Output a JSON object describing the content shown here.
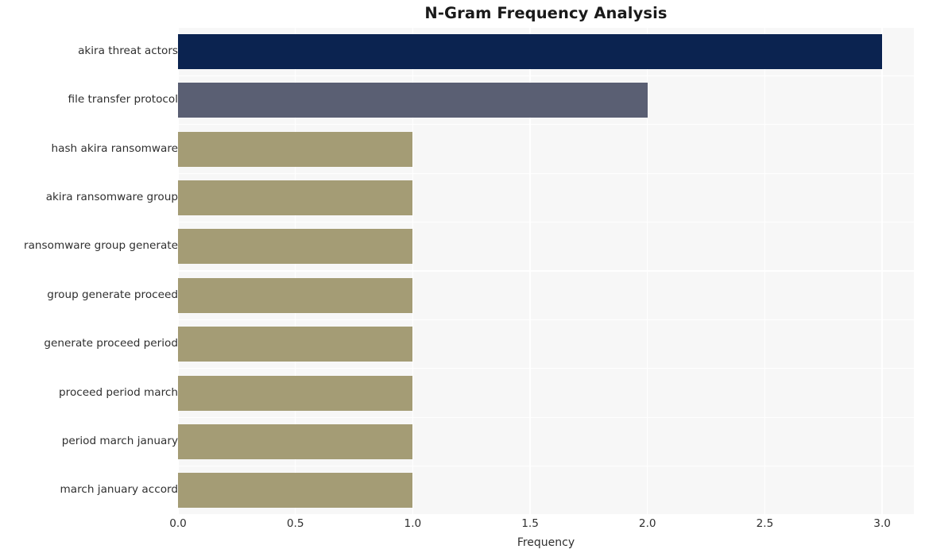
{
  "chart_data": {
    "type": "bar",
    "orientation": "horizontal",
    "title": "N-Gram Frequency Analysis",
    "xlabel": "Frequency",
    "ylabel": "",
    "xlim": [
      0,
      3.135
    ],
    "xticks": [
      "0.0",
      "0.5",
      "1.0",
      "1.5",
      "2.0",
      "2.5",
      "3.0"
    ],
    "xtick_values": [
      0.0,
      0.5,
      1.0,
      1.5,
      2.0,
      2.5,
      3.0
    ],
    "grid": true,
    "legend": "none",
    "categories": [
      "akira threat actors",
      "file transfer protocol",
      "hash akira ransomware",
      "akira ransomware group",
      "ransomware group generate",
      "group generate proceed",
      "generate proceed period",
      "proceed period march",
      "period march january",
      "march january accord"
    ],
    "values": [
      3,
      2,
      1,
      1,
      1,
      1,
      1,
      1,
      1,
      1
    ],
    "bar_colors": [
      "#0b2350",
      "#5a5f73",
      "#a49c75",
      "#a49c75",
      "#a49c75",
      "#a49c75",
      "#a49c75",
      "#a49c75",
      "#a49c75",
      "#a49c75"
    ],
    "plot_background": "#f7f7f7",
    "gridline_color": "#ffffff",
    "figure_background": "#ffffff",
    "text_color": "#2f2f2f",
    "title_color": "#1a1a1a"
  }
}
